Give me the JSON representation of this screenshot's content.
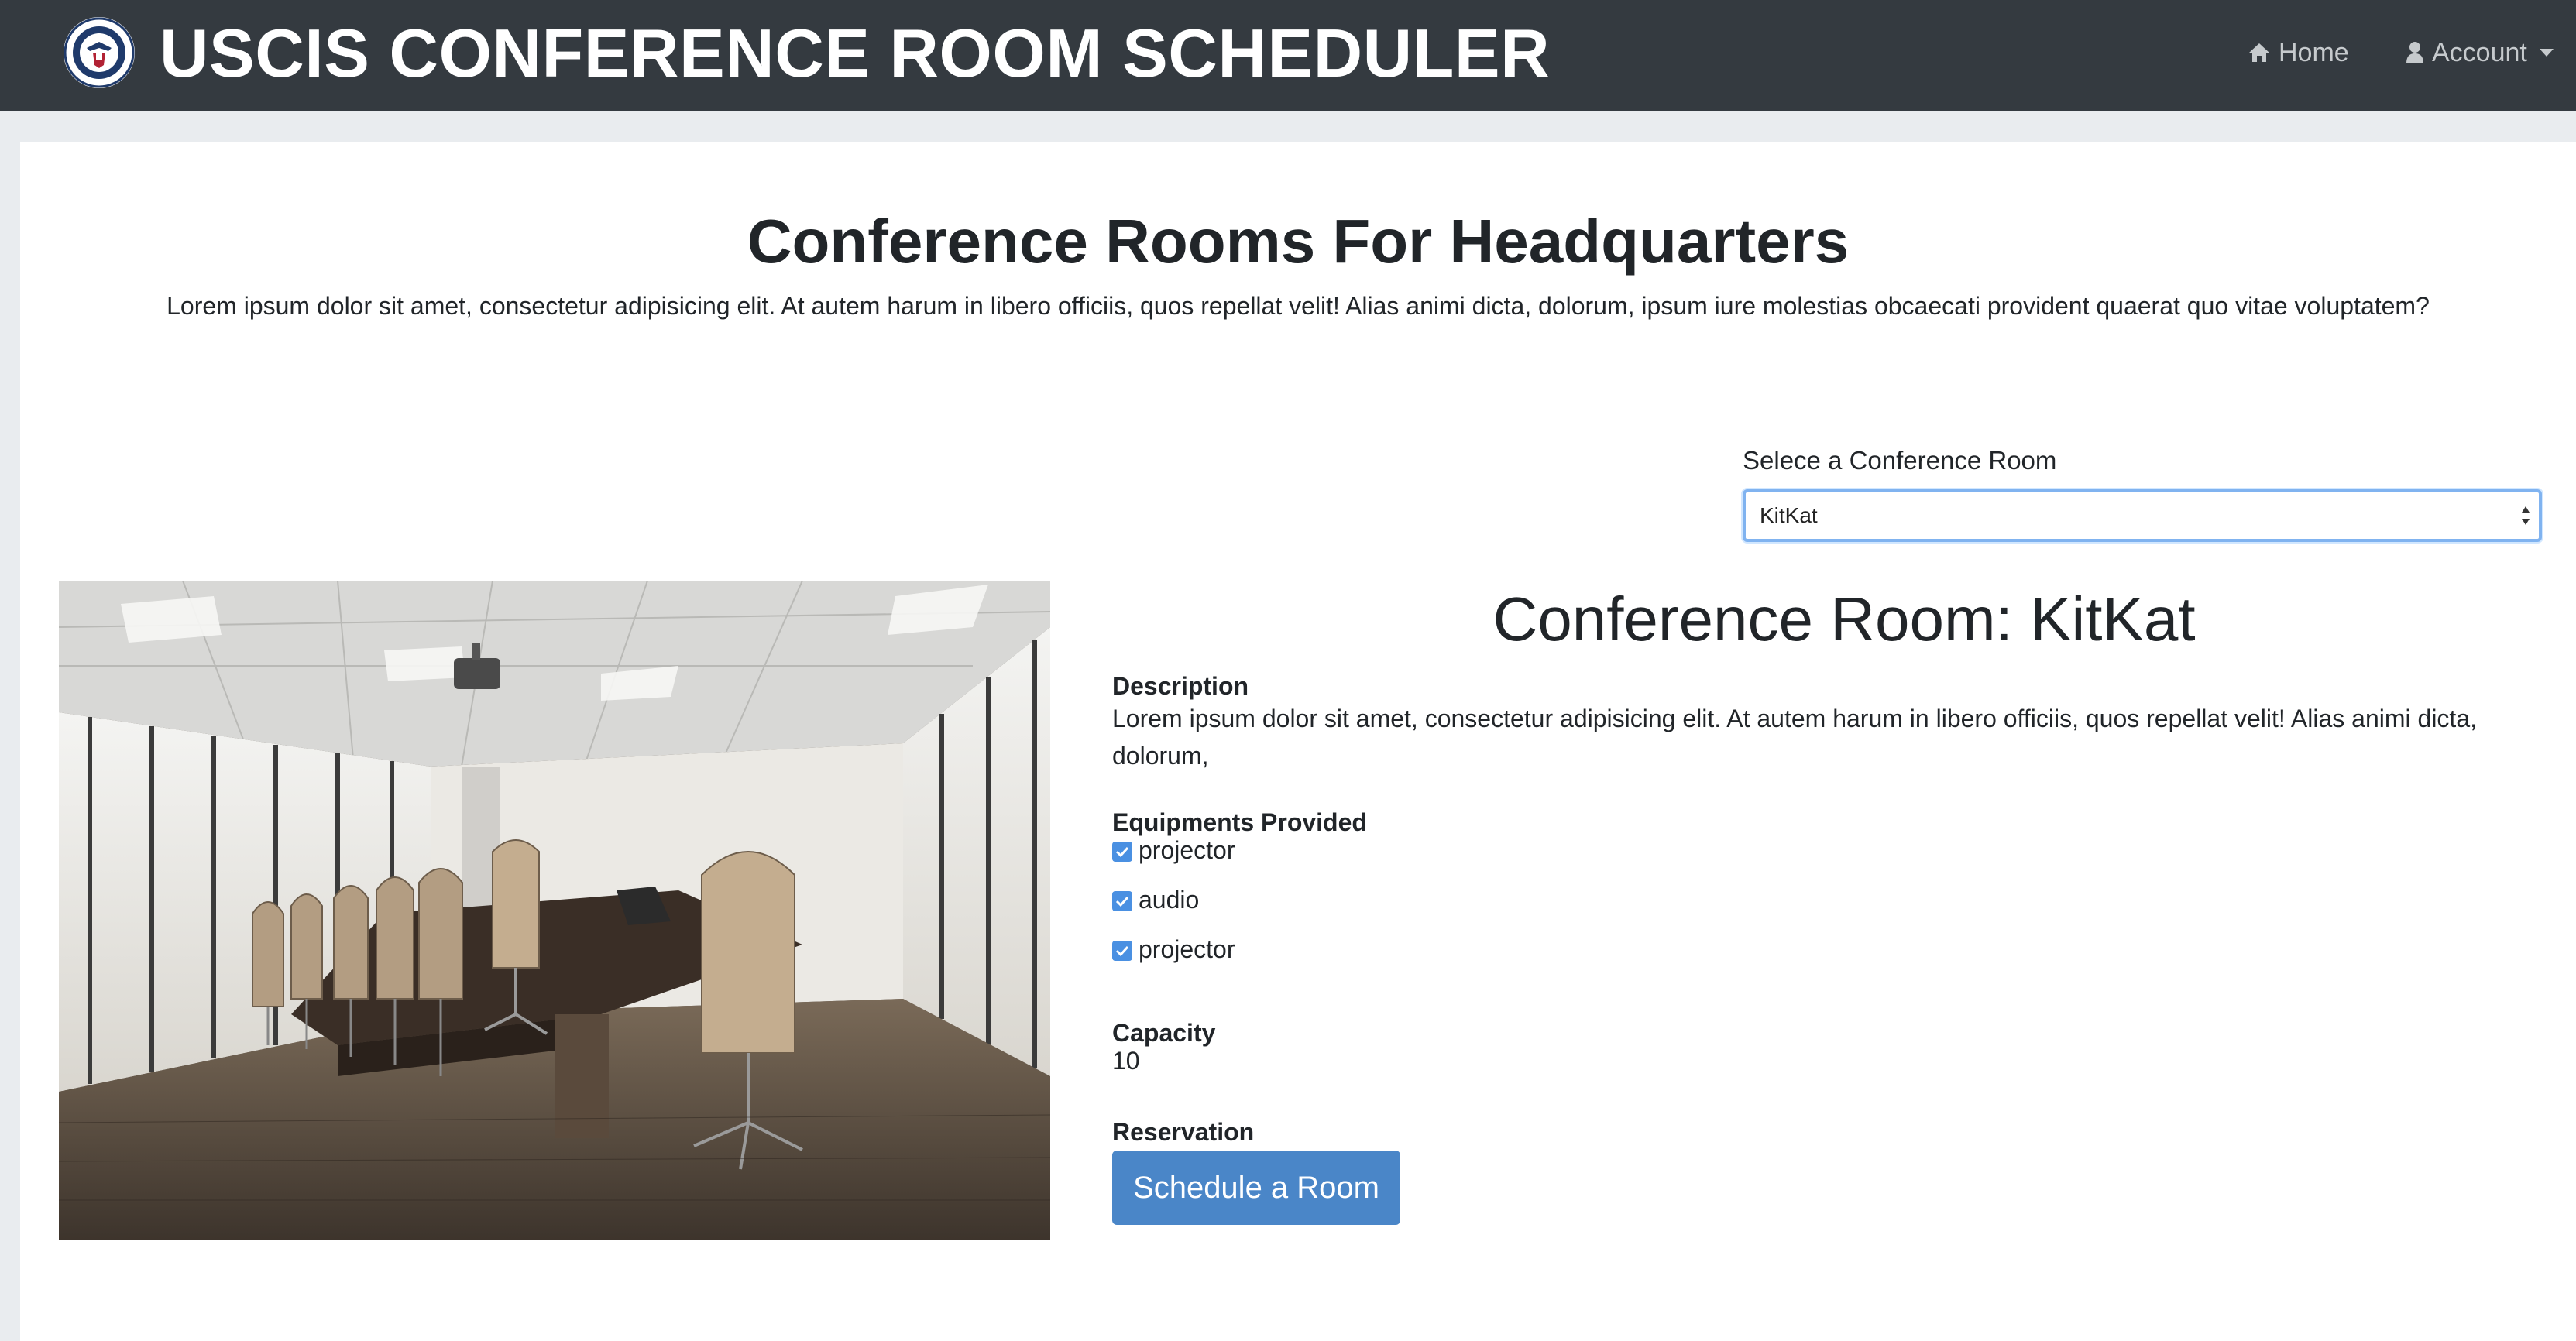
{
  "navbar": {
    "brand_title": "USCIS CONFERENCE ROOM SCHEDULER",
    "home_label": "Home",
    "account_label": "Account"
  },
  "page": {
    "title": "Conference Rooms For Headquarters",
    "lead": "Lorem ipsum dolor sit amet, consectetur adipisicing elit. At autem harum in libero officiis, quos repellat velit! Alias animi dicta, dolorum, ipsum iure molestias obcaecati provident quaerat quo vitae voluptatem?"
  },
  "selector": {
    "label": "Selece a Conference Room",
    "selected_value": "KitKat"
  },
  "room": {
    "heading": "Conference Room: KitKat",
    "description_label": "Description",
    "description_text": "Lorem ipsum dolor sit amet, consectetur adipisicing elit. At autem harum in libero officiis, quos repellat velit! Alias animi dicta, dolorum,",
    "equipment_label": "Equipments Provided",
    "equipment": [
      {
        "label": "projector",
        "checked": true
      },
      {
        "label": "audio",
        "checked": true
      },
      {
        "label": "projector",
        "checked": true
      }
    ],
    "capacity_label": "Capacity",
    "capacity_value": "10",
    "reservation_label": "Reservation",
    "schedule_button": "Schedule a Room"
  },
  "colors": {
    "navbar_bg": "#343a40",
    "page_bg": "#e9ecef",
    "button_bg": "#4a86c8",
    "checkbox": "#4a90e2",
    "select_focus": "#80b3f0"
  },
  "icons": {
    "brand": "dhs-seal-icon",
    "home": "home-icon",
    "account": "user-icon",
    "select": "select-arrows-icon",
    "check": "checkmark-icon"
  }
}
